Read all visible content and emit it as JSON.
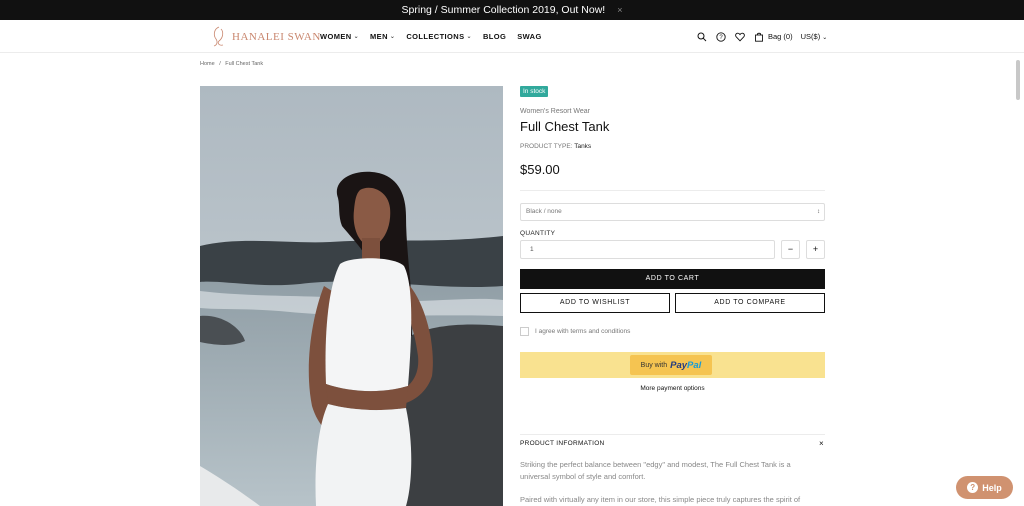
{
  "promo": {
    "text": "Spring / Summer Collection 2019, Out Now!",
    "close": "×"
  },
  "brand": {
    "name": "HANALEI SWAN",
    "color": "#c9876f"
  },
  "nav": {
    "items": [
      {
        "label": "WOMEN",
        "has_dropdown": true
      },
      {
        "label": "MEN",
        "has_dropdown": true
      },
      {
        "label": "COLLECTIONS",
        "has_dropdown": true
      },
      {
        "label": "BLOG",
        "has_dropdown": false
      },
      {
        "label": "SWAG",
        "has_dropdown": false
      }
    ]
  },
  "header_actions": {
    "icons": [
      "search-icon",
      "help-circle-icon",
      "heart-icon",
      "bag-icon"
    ],
    "bag_label": "Bag (0)",
    "currency": "US($)"
  },
  "breadcrumb": {
    "home": "Home",
    "separator": "/",
    "current": "Full Chest Tank"
  },
  "product": {
    "badge": "In stock",
    "badge_color": "#31a99c",
    "vendor": "Women's Resort Wear",
    "title": "Full Chest Tank",
    "type_label": "PRODUCT TYPE:",
    "type_value": "Tanks",
    "price": "$59.00",
    "variant": "Black / none",
    "quantity_label": "QUANTITY",
    "quantity": "1",
    "minus": "−",
    "plus": "+",
    "add_to_cart": "ADD TO CART",
    "add_to_wishlist": "ADD TO WISHLIST",
    "add_to_compare": "ADD TO COMPARE",
    "terms": "I agree with terms and conditions",
    "paypal_buy": "Buy with",
    "paypal_pay": "Pay",
    "paypal_pal": "Pal",
    "more_payment": "More payment options"
  },
  "product_info": {
    "title": "PRODUCT INFORMATION",
    "close": "×",
    "paragraph1": "Striking the perfect balance between \"edgy\" and modest, The Full Chest Tank is a universal symbol of style and comfort.",
    "paragraph2": "Paired with virtually any item in our store, this simple piece truly captures the spirit of"
  },
  "help": {
    "label": "Help",
    "color": "#d09270"
  }
}
